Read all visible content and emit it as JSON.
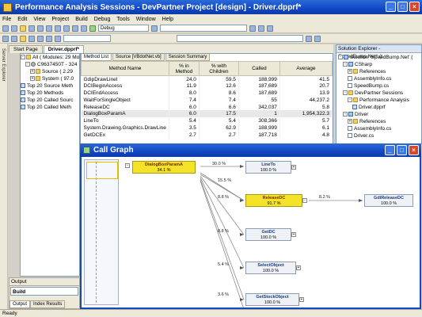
{
  "window": {
    "title": "Performance Analysis Sessions - DevPartner Project [design] - Driver.dpprf*"
  },
  "menu": [
    "File",
    "Edit",
    "View",
    "Project",
    "Build",
    "Debug",
    "Tools",
    "Window",
    "Help"
  ],
  "toolbar": {
    "config": "Debug"
  },
  "side_strip": {
    "server_explorer": "Server Explorer"
  },
  "doc_tabs": [
    "Start Page",
    "Driver.dpprf*"
  ],
  "left_tree": {
    "items": [
      "All ( Modules: 29 Mo",
      "C9637450T - 324",
      "Source ( 2.29",
      "System ( 97.0",
      "Top 20 Source Meth",
      "Top 20 Methods",
      "Top 20 Called Sourc",
      "Top 20 Called Meth"
    ]
  },
  "method_tabs": [
    "Method List",
    "Source [VBdotNet.vb]",
    "Session Summary"
  ],
  "method_table": {
    "headers": [
      "Method Name",
      "% in Method",
      "% with Children",
      "Called",
      "Average"
    ],
    "rows": [
      [
        "GdipDrawLineI",
        "24.0",
        "59.5",
        "188,999",
        "41.5"
      ],
      [
        "DCIBeginAccess",
        "11.9",
        "12.6",
        "187,689",
        "20.7"
      ],
      [
        "DCIEndAccess",
        "8.0",
        "8.6",
        "187,689",
        "13.9"
      ],
      [
        "WaitForSingleObject",
        "7.4",
        "7.4",
        "55",
        "44,237.2"
      ],
      [
        "ReleaseDC",
        "6.0",
        "6.6",
        "342,037",
        "5.8"
      ],
      [
        "DialogBoxParamA",
        "6.0",
        "17.5",
        "1",
        "1,954,322.3"
      ],
      [
        "LineTo",
        "5.4",
        "5.4",
        "308,366",
        "5.7"
      ],
      [
        "System.Drawing.Graphics.DrawLine",
        "3.5",
        "62.9",
        "188,999",
        "6.1"
      ],
      [
        "GetDCEx",
        "2.7",
        "2.7",
        "187,718",
        "4.8"
      ]
    ]
  },
  "solution_explorer": {
    "title": "Solution Explorer - SpeedBump.Net* (t",
    "items": [
      "Solution 'SpeedBump.Net' (",
      "CSharp",
      "References",
      "AssemblyInfo.cs",
      "SpeedBump.cs",
      "DevPartner Sessions",
      "Performance Analysis",
      "Driver.dpprf",
      "Driver",
      "References",
      "AssemblyInfo.cs",
      "Driver.cs"
    ]
  },
  "output_panel": {
    "title": "Output",
    "field": "Build",
    "tabs": [
      "Output",
      "Index Results"
    ]
  },
  "call_graph": {
    "title": "Call Graph",
    "root": {
      "name": "DialogBoxParamA",
      "pct": "34.1 %"
    },
    "children": [
      {
        "name": "LineTo",
        "pct": "100.0 %",
        "edge": "30.0 %"
      },
      {
        "name": "ReleaseDC",
        "pct": "91.7 %",
        "edge": "8.8 %"
      },
      {
        "name": "GetDC",
        "pct": "100.0 %",
        "edge": "8.8 %"
      },
      {
        "name": "SelectObject",
        "pct": "100.0 %",
        "edge": "5.4 %"
      },
      {
        "name": "GetStockObject",
        "pct": "100.0 %",
        "edge": "3.6 %"
      }
    ],
    "edge_extra": "15.5 %",
    "grandchild": {
      "name": "GdiReleaseDC",
      "pct": "100.0 %",
      "edge": "8.2 %"
    }
  },
  "status": {
    "text": "Ready"
  }
}
